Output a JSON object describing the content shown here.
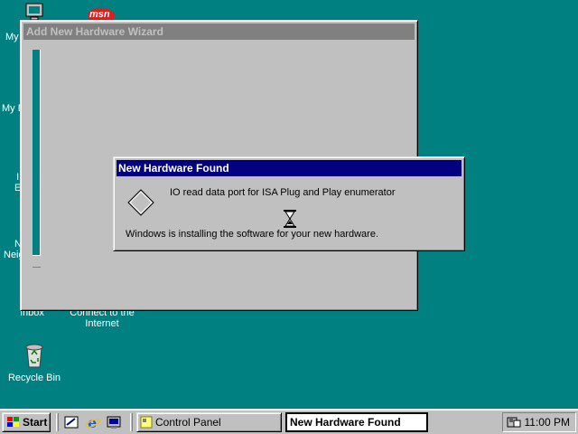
{
  "desktop": {
    "icons": [
      {
        "label": "My"
      },
      {
        "label": "My D"
      },
      {
        "label": "I"
      },
      {
        "label": "E"
      },
      {
        "label": "N"
      },
      {
        "label": "Neig"
      },
      {
        "label": "Inbox"
      },
      {
        "label": "Connect to the"
      },
      {
        "label": "Internet"
      },
      {
        "label": "Recycle Bin"
      }
    ],
    "msn_label": "msn"
  },
  "wizard": {
    "title": "Add New Hardware Wizard"
  },
  "new_hardware_dialog": {
    "title": "New Hardware Found",
    "device_name": "IO read data port for ISA Plug and Play enumerator",
    "status": "Windows is installing the software for your new hardware."
  },
  "taskbar": {
    "start_label": "Start",
    "quick_launch": [
      "desktop-icon",
      "ie-icon",
      "channels-icon"
    ],
    "tasks": [
      {
        "label": "Control Panel",
        "active": false
      },
      {
        "label": "New Hardware Found",
        "active": true
      }
    ],
    "clock": "11:00 PM"
  },
  "colors": {
    "desktop": "#008080",
    "active_title": "#000080",
    "inactive_title": "#808080",
    "face": "#c0c0c0"
  }
}
